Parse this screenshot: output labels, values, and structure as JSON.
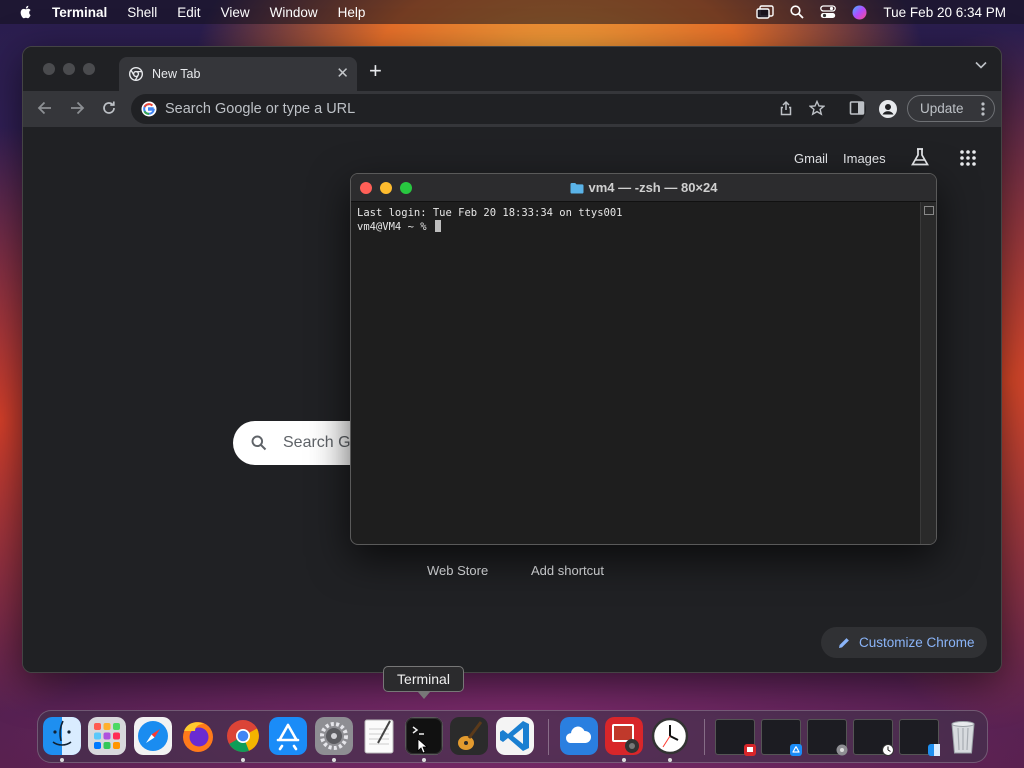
{
  "menubar": {
    "app_name": "Terminal",
    "items": [
      "Shell",
      "Edit",
      "View",
      "Window",
      "Help"
    ],
    "clock": "Tue Feb 20  6:34 PM"
  },
  "chrome": {
    "tab_title": "New Tab",
    "tab_close": "✕",
    "new_tab": "+",
    "omnibox_placeholder": "Search Google or type a URL",
    "update_label": "Update",
    "links": {
      "gmail": "Gmail",
      "images": "Images"
    },
    "search_box_text": "Search Go",
    "shortcuts": [
      "Web Store",
      "Add shortcut"
    ],
    "customize_label": "Customize Chrome"
  },
  "terminal": {
    "title": "vm4 — -zsh — 80×24",
    "lines": [
      "Last login: Tue Feb 20 18:33:34 on ttys001",
      "vm4@VM4 ~ % "
    ]
  },
  "tooltip": "Terminal",
  "colors": {
    "traffic_red": "#ff5f57",
    "traffic_yellow": "#febc2e",
    "traffic_green": "#28c840",
    "link_blue": "#8ab4f8"
  },
  "dock": {
    "apps": [
      "finder",
      "launchpad",
      "safari",
      "firefox",
      "chrome",
      "app-store",
      "system-settings",
      "textedit",
      "terminal",
      "garageband",
      "vscode",
      "weather",
      "photo-booth",
      "clock"
    ]
  }
}
